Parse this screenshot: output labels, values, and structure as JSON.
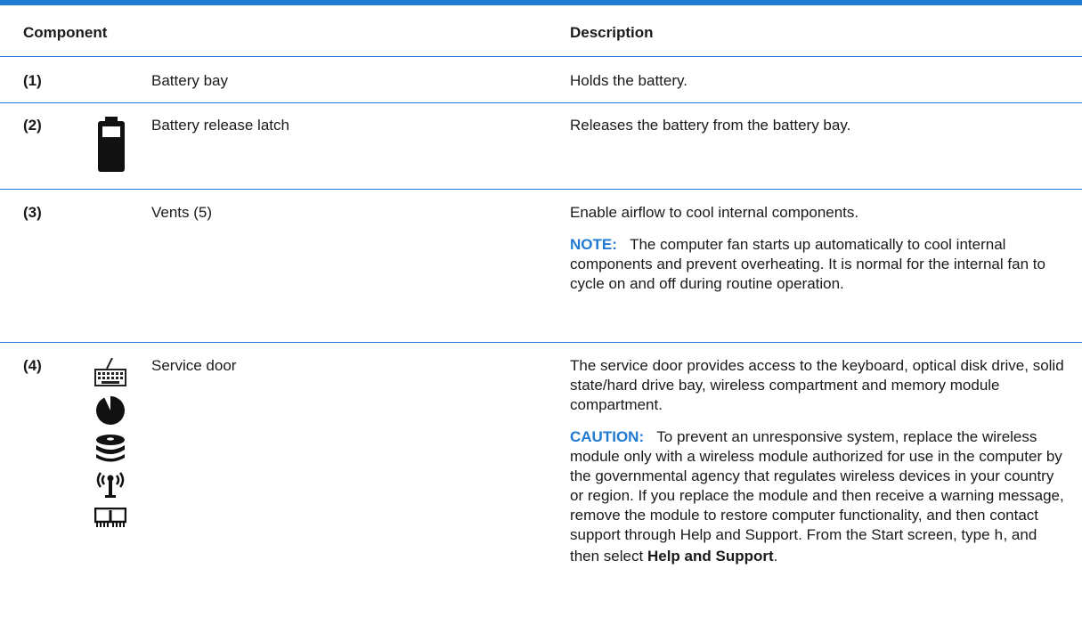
{
  "header": {
    "component": "Component",
    "description": "Description"
  },
  "rows": [
    {
      "number": "(1)",
      "name": "Battery bay",
      "description": "Holds the battery."
    },
    {
      "number": "(2)",
      "name": "Battery release latch",
      "description": "Releases the battery from the battery bay."
    },
    {
      "number": "(3)",
      "name": "Vents (5)",
      "description": "Enable airflow to cool internal components.",
      "note_label": "NOTE:",
      "note_text": "The computer fan starts up automatically to cool internal components and prevent overheating. It is normal for the internal fan to cycle on and off during routine operation."
    },
    {
      "number": "(4)",
      "name": "Service door",
      "description": "The service door provides access to the keyboard, optical disk drive, solid state/hard drive bay, wireless compartment and memory module compartment.",
      "caution_label": "CAUTION:",
      "caution_text": "To prevent an unresponsive system, replace the wireless module only with a wireless module authorized for use in the computer by the governmental agency that regulates wireless devices in your country or region. If you replace the module and then receive a warning message, remove the module to restore computer functionality, and then contact support through Help and Support. From the Start screen, type",
      "caution_key": "h",
      "caution_after_key": ", and then select",
      "caution_link": "Help and Support",
      "caution_end": "."
    }
  ],
  "icons": {
    "row2": "battery-icon",
    "row4": [
      "keyboard-icon",
      "optical-disc-icon",
      "drive-stack-icon",
      "wireless-antenna-icon",
      "memory-module-icon"
    ]
  }
}
